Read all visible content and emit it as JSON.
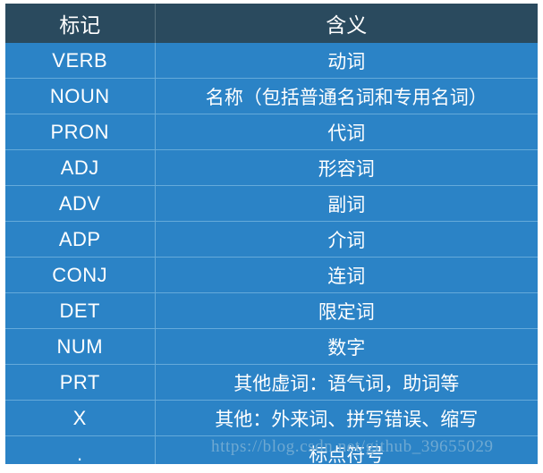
{
  "table": {
    "columns": [
      {
        "key": "tag",
        "label": "标记"
      },
      {
        "key": "meaning",
        "label": "含义"
      }
    ],
    "rows": [
      {
        "tag": "VERB",
        "meaning": "动词"
      },
      {
        "tag": "NOUN",
        "meaning": "名称（包括普通名词和专用名词）"
      },
      {
        "tag": "PRON",
        "meaning": "代词"
      },
      {
        "tag": "ADJ",
        "meaning": "形容词"
      },
      {
        "tag": "ADV",
        "meaning": "副词"
      },
      {
        "tag": "ADP",
        "meaning": "介词"
      },
      {
        "tag": "CONJ",
        "meaning": "连词"
      },
      {
        "tag": "DET",
        "meaning": "限定词"
      },
      {
        "tag": "NUM",
        "meaning": "数字"
      },
      {
        "tag": "PRT",
        "meaning": "其他虚词：语气词，助词等"
      },
      {
        "tag": "X",
        "meaning": "其他：外来词、拼写错误、缩写"
      },
      {
        "tag": ".",
        "meaning": "标点符号"
      }
    ]
  },
  "watermark": {
    "text": "https://blog.csdn.net/github_39655029"
  },
  "colors": {
    "header_background": "#2a4a5e",
    "row_background": "#2b83c6",
    "grid_line": "#65aada",
    "text": "#ffffff",
    "watermark_text": "#6fa9d2",
    "page_background": "#ffffff"
  }
}
